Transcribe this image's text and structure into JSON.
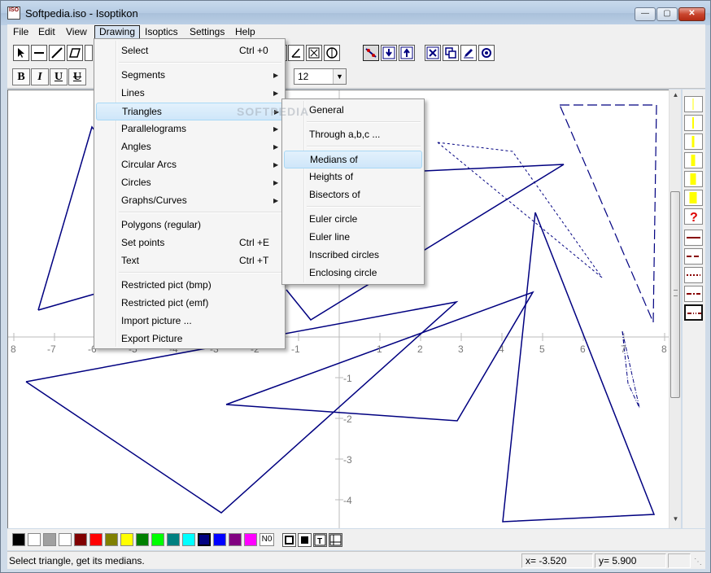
{
  "window": {
    "title": "Softpedia.iso - Isoptikon",
    "app_icon_text": "ISO"
  },
  "menubar": [
    "File",
    "Edit",
    "View",
    "Drawing",
    "Isoptics",
    "Settings",
    "Help"
  ],
  "toolbar": {
    "font_size": "12"
  },
  "format_buttons": [
    "B",
    "I",
    "U",
    "U"
  ],
  "drawing_menu": {
    "items": [
      {
        "label": "Select",
        "shortcut": "Ctrl +0"
      },
      {
        "label": "Segments",
        "submenu": true
      },
      {
        "label": "Lines",
        "submenu": true
      },
      {
        "label": "Triangles",
        "submenu": true,
        "highlighted": true
      },
      {
        "label": "Parallelograms",
        "submenu": true
      },
      {
        "label": "Angles",
        "submenu": true
      },
      {
        "label": "Circular Arcs",
        "submenu": true
      },
      {
        "label": "Circles",
        "submenu": true
      },
      {
        "label": "Graphs/Curves",
        "submenu": true
      },
      {
        "label": "Polygons (regular)"
      },
      {
        "label": "Set points",
        "shortcut": "Ctrl +E"
      },
      {
        "label": "Text",
        "shortcut": "Ctrl +T"
      },
      {
        "label": "Restricted pict (bmp)"
      },
      {
        "label": "Restricted pict (emf)"
      },
      {
        "label": "Import picture ..."
      },
      {
        "label": "Export Picture"
      }
    ]
  },
  "triangles_submenu": {
    "items": [
      {
        "label": "General"
      },
      {
        "label": "Through a,b,c ..."
      },
      {
        "label": "Medians of",
        "highlighted": true
      },
      {
        "label": "Heights of"
      },
      {
        "label": "Bisectors of"
      },
      {
        "label": "Euler circle"
      },
      {
        "label": "Euler line"
      },
      {
        "label": "Inscribed circles"
      },
      {
        "label": "Enclosing circle"
      }
    ]
  },
  "axes": {
    "x_ticks": [
      "8",
      "-7",
      "-6",
      "-5",
      "-4",
      "-3",
      "-2",
      "-1",
      "0",
      "1",
      "2",
      "3",
      "4",
      "5",
      "6",
      "7",
      "8"
    ],
    "y_ticks": [
      "-1",
      "-2",
      "-3",
      "-4"
    ]
  },
  "palette": {
    "colors": [
      "#000000",
      "#ffffff",
      "#a0a0a0",
      "#ffffff",
      "#800000",
      "#ff0000",
      "#808000",
      "#ffff00",
      "#008000",
      "#00ff00",
      "#008080",
      "#00ffff",
      "#000080",
      "#0000ff",
      "#800080",
      "#ff00ff"
    ],
    "no_color_label": "N0",
    "selected_color": "#000080"
  },
  "statusbar": {
    "message": "Select triangle, get its medians.",
    "x": "x= -3.520",
    "y": "y= 5.900"
  },
  "watermark": "SOFTPEDIA"
}
